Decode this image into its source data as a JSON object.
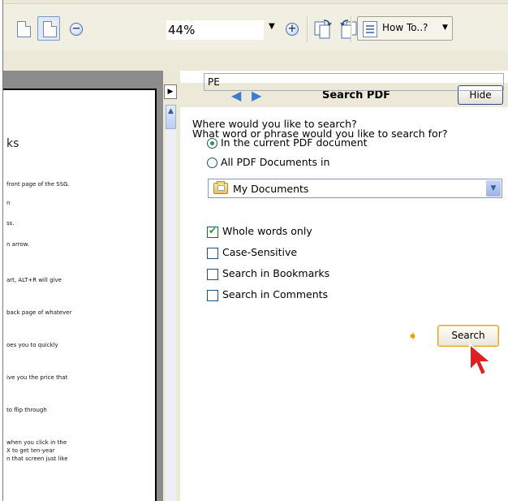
{
  "toolbar": {
    "zoom_value": "44%",
    "zoom_out_icon": "minus-circle-icon",
    "zoom_in_icon": "plus-circle-icon",
    "how_to_label": "How To..?"
  },
  "document": {
    "title_fragment": "ks",
    "lines": [
      "front page of the SSG.",
      "n",
      "ss.",
      "n arrow.",
      "art, ALT+R will give",
      "back page of whatever",
      "oes you to quickly",
      "ive you the price that",
      "to flip through",
      "when you click in the",
      "X to get ten-year",
      "n that screen just like"
    ]
  },
  "search_panel": {
    "title": "Search PDF",
    "hide_label": "Hide",
    "question": "What word or phrase would you like to search for?",
    "query_value": "PE",
    "where_label": "Where would you like to search?",
    "options": [
      {
        "label": "In the current PDF document",
        "selected": true
      },
      {
        "label": "All PDF Documents in",
        "selected": false
      }
    ],
    "location_value": "My Documents",
    "checkboxes": [
      {
        "label": "Whole words only",
        "checked": true
      },
      {
        "label": "Case-Sensitive",
        "checked": false
      },
      {
        "label": "Search in Bookmarks",
        "checked": false
      },
      {
        "label": "Search in Comments",
        "checked": false
      }
    ],
    "search_label": "Search"
  },
  "colors": {
    "accent_blue": "#3c7ccd",
    "arrow_orange": "#e7a300",
    "check_green": "#21a121"
  }
}
